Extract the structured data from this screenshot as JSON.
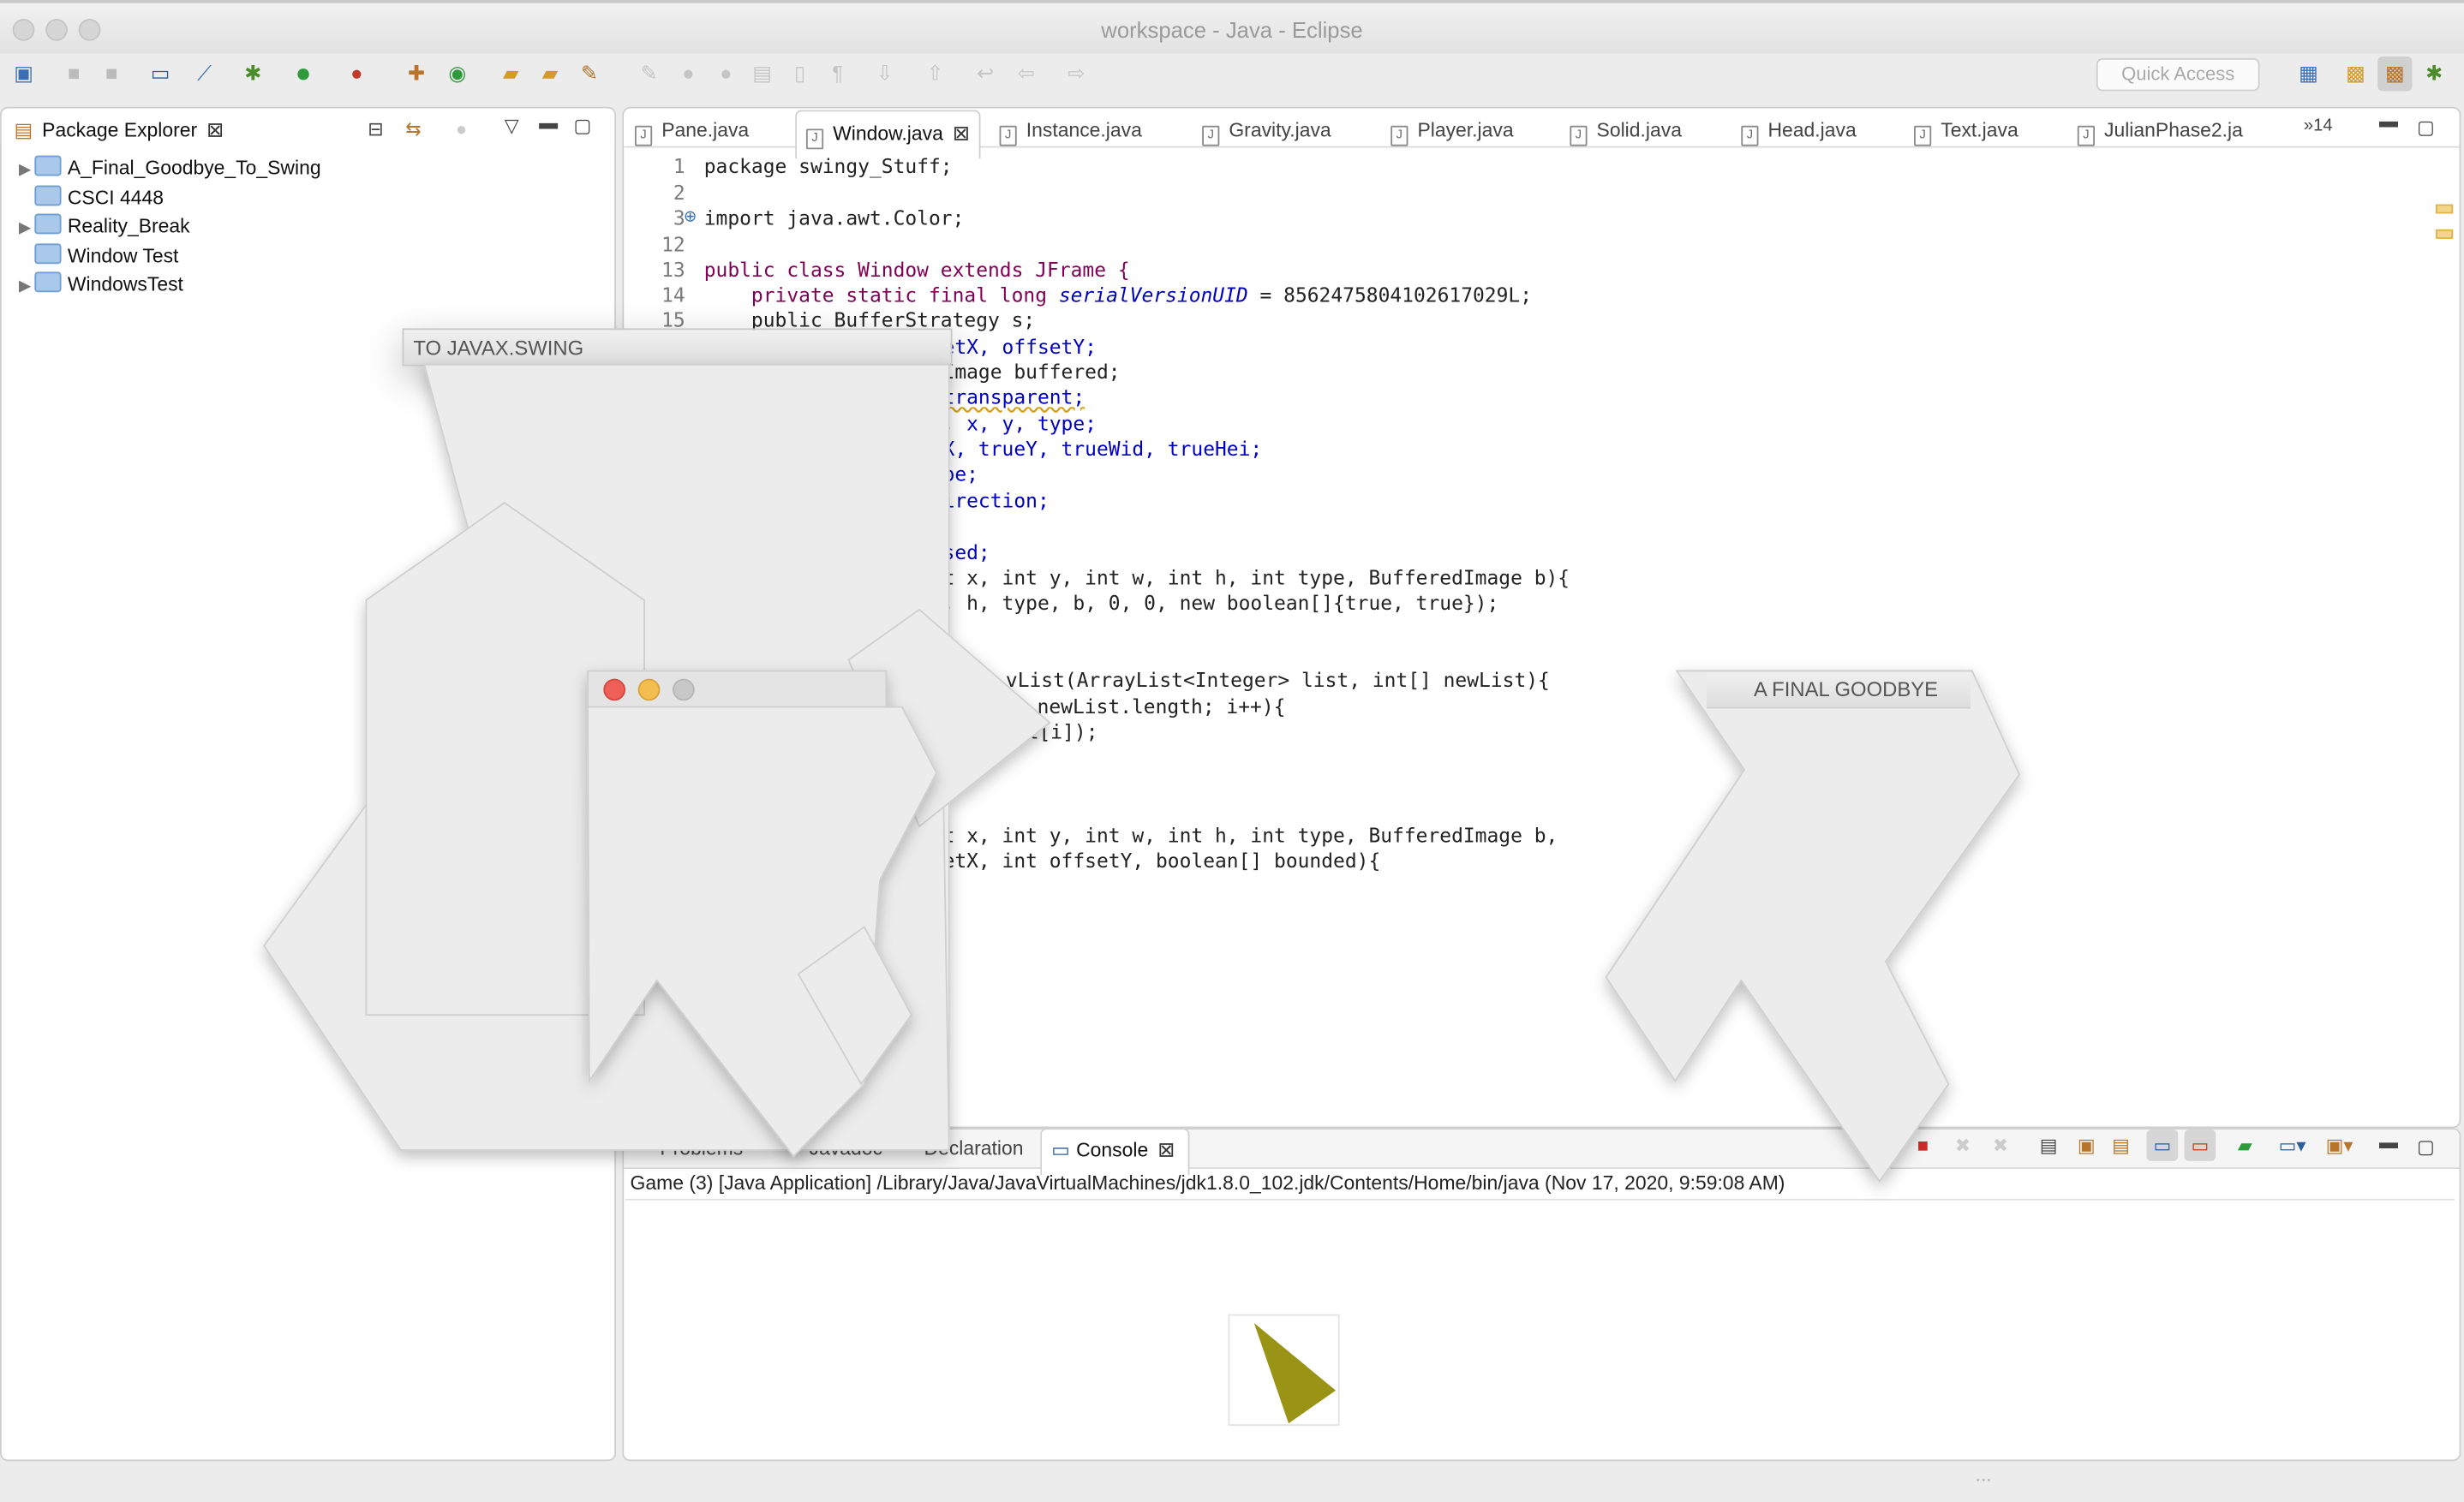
{
  "window": {
    "title": "workspace - Java - Eclipse"
  },
  "toolbar": {
    "quick_access": "Quick Access"
  },
  "package_explorer": {
    "tab_label": "Package Explorer",
    "items": [
      {
        "label": "A_Final_Goodbye_To_Swing",
        "expandable": true
      },
      {
        "label": "CSCI 4448",
        "expandable": false
      },
      {
        "label": "Reality_Break",
        "expandable": true
      },
      {
        "label": "Window Test",
        "expandable": false
      },
      {
        "label": "WindowsTest",
        "expandable": true
      }
    ]
  },
  "editor": {
    "tabs": [
      "Pane.java",
      "Window.java",
      "Instance.java",
      "Gravity.java",
      "Player.java",
      "Solid.java",
      "Head.java",
      "Text.java",
      "JulianPhase2.ja"
    ],
    "active_tab": "Window.java",
    "overflow_count": "14",
    "line_numbers": [
      "1",
      "2",
      "3",
      "12",
      "13",
      "14",
      "15"
    ],
    "lines": {
      "l1": "package swingy_Stuff;",
      "l3": "import java.awt.Color;",
      "l13": "public class Window extends JFrame {",
      "l14a": "    private static final long ",
      "l14b": "serialVersionUID",
      "l14c": " = 8562475804102617029L;",
      "l15": "    public BufferStrategy s;",
      "f1": "etX, offsetY;",
      "f2": "Image buffered;",
      "f3": "transparent;",
      "f4": ", x, y, type;",
      "f5": "X, trueY, trueWid, trueHei;",
      "f6": "pe;",
      "f7": "irection;",
      "f8": "sed;",
      "f9": "t x, int y, int w, int h, int type, BufferedImage b){",
      "f10": ", h, type, b, 0, 0, new boolean[]{true, true});",
      "f11": "vList(ArrayList<Integer> list, int[] newList){",
      "f12": "newList.length; i++){",
      "f13": "st[i]);",
      "f14": "t x, int y, int w, int h, int type, BufferedImage b,",
      "f15": "etX, int offsetY, boolean[] bounded){"
    }
  },
  "bottom_panel": {
    "tabs": [
      "Problems",
      "Javadoc",
      "Declaration",
      "Console"
    ],
    "active_tab": "Console",
    "console_header": "Game (3) [Java Application] /Library/Java/JavaVirtualMachines/jdk1.8.0_102.jdk/Contents/Home/bin/java (Nov 17, 2020, 9:59:08 AM)"
  },
  "overlay_windows": {
    "left_title": "TO JAVAX.SWING",
    "right_title": "A FINAL GOODBYE"
  },
  "colors": {
    "traffic_red": "#ed5f57",
    "traffic_yellow": "#f3be4f",
    "traffic_gray": "#c8c8c8",
    "keyword": "#7f0055",
    "field": "#0000c0",
    "olive_shape": "#9a9416"
  }
}
